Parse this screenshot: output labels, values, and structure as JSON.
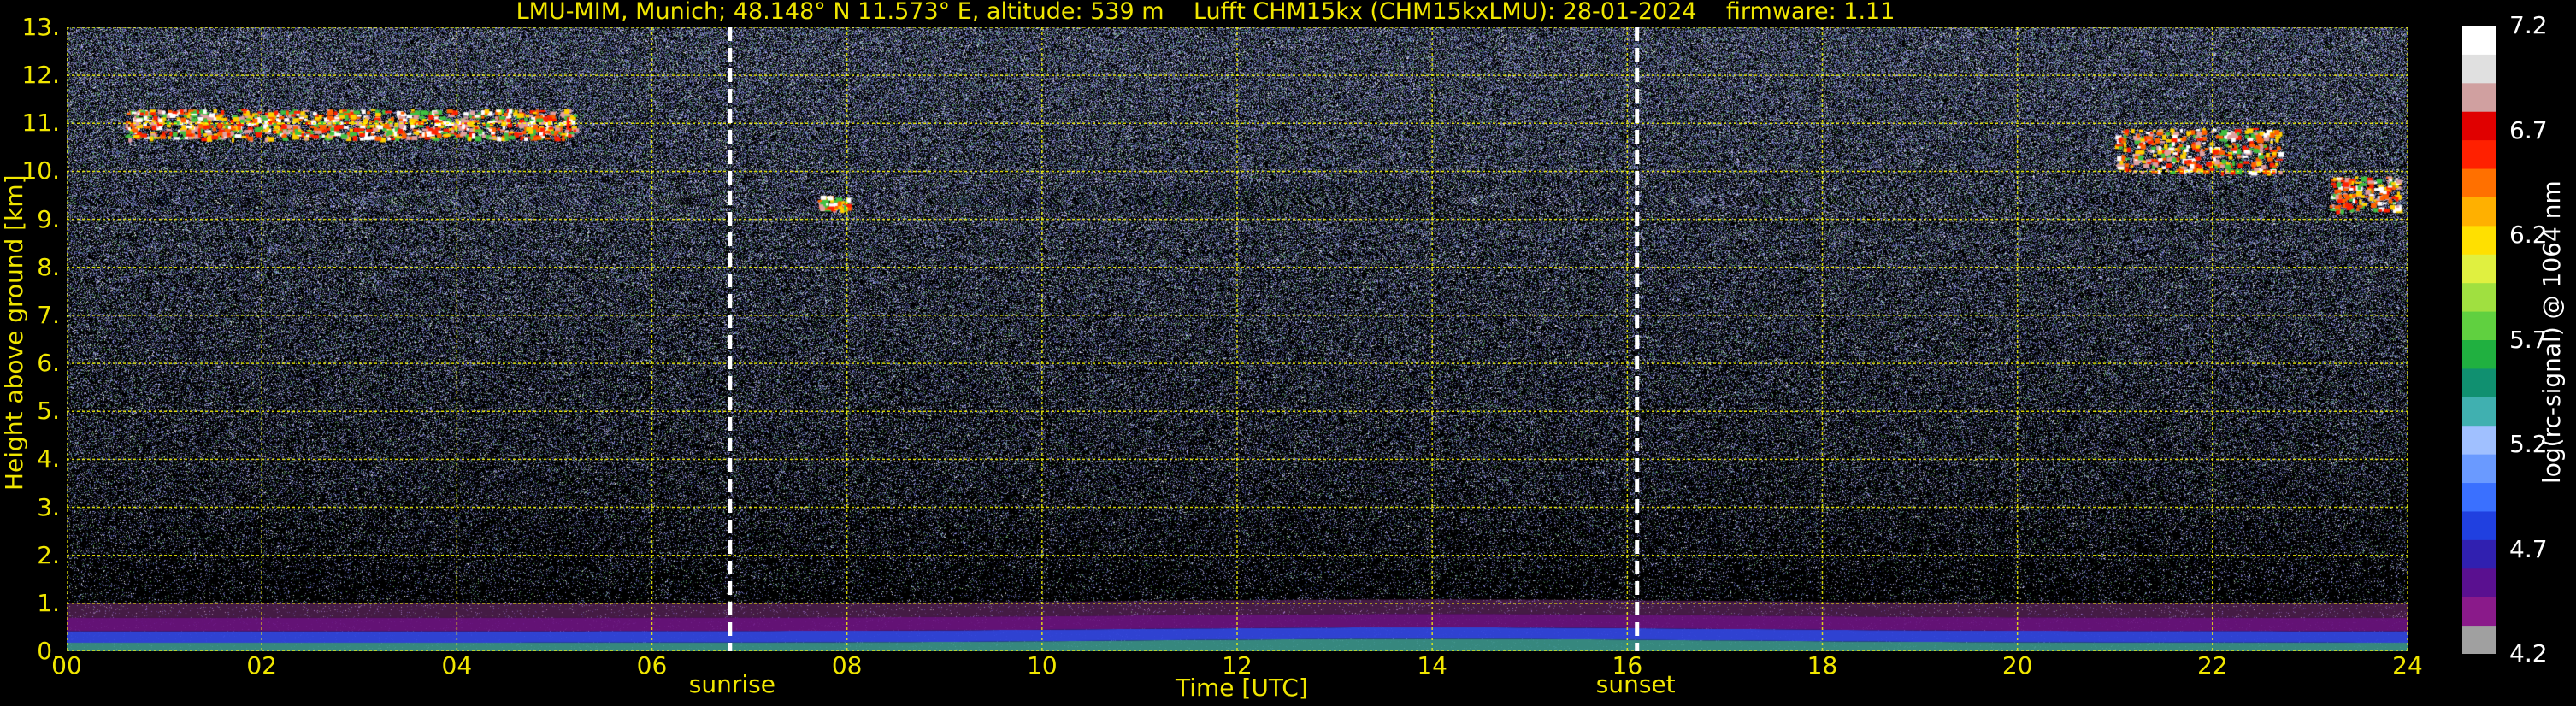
{
  "header": {
    "title": "LMU-MIM, Munich; 48.148° N 11.573° E, altitude: 539 m    Lufft CHM15kx (CHM15kxLMU): 28-01-2024    firmware: 1.11"
  },
  "chart_data": {
    "type": "heatmap",
    "xlabel": "Time [UTC]",
    "ylabel": "Height above ground [km]",
    "xlim": [
      0,
      24
    ],
    "ylim": [
      0,
      13
    ],
    "x_tick_labels": [
      "00",
      "02",
      "04",
      "06",
      "08",
      "10",
      "12",
      "14",
      "16",
      "18",
      "20",
      "22",
      "24"
    ],
    "y_tick_labels": [
      "0.",
      "1.",
      "2.",
      "3.",
      "4.",
      "5.",
      "6.",
      "7.",
      "8.",
      "9.",
      "10.",
      "11.",
      "12.",
      "13."
    ],
    "grid": true,
    "grid_color": "#ffff00",
    "background_color": "#000000",
    "annotations": [
      {
        "label": "sunrise",
        "x": 6.8
      },
      {
        "label": "sunset",
        "x": 16.1
      }
    ],
    "colorbar": {
      "label": "log(rc-signal) @ 1064 nm",
      "range": [
        4.2,
        7.2
      ],
      "tick_values": [
        4.2,
        4.7,
        5.2,
        5.7,
        6.2,
        6.7,
        7.2
      ],
      "tick_labels": [
        "4.2",
        "4.7",
        "5.2",
        "5.7",
        "6.2",
        "6.7",
        "7.2"
      ],
      "colors": [
        "#a0a0a0",
        "#8a1a8a",
        "#5a1090",
        "#3020b0",
        "#2040e0",
        "#3a70ff",
        "#6a9aff",
        "#a0c0ff",
        "#40b0b0",
        "#109070",
        "#20b040",
        "#60d040",
        "#a0e040",
        "#e0f040",
        "#ffe000",
        "#ffb000",
        "#ff7000",
        "#ff2000",
        "#e00000",
        "#d0a0a0",
        "#e0e0e0",
        "#ffffff"
      ]
    },
    "features": [
      {
        "name": "boundary layer",
        "x_range": [
          0,
          24
        ],
        "y_range": [
          0,
          0.6
        ]
      },
      {
        "name": "cirrus",
        "x_range": [
          0.6,
          5.2
        ],
        "y_range": [
          10.7,
          11.3
        ]
      },
      {
        "name": "cirrus",
        "x_range": [
          7.7,
          8.0
        ],
        "y_range": [
          9.2,
          9.5
        ]
      },
      {
        "name": "cirrus",
        "x_range": [
          21.0,
          22.7
        ],
        "y_range": [
          10.0,
          10.9
        ]
      },
      {
        "name": "cirrus",
        "x_range": [
          23.2,
          23.9
        ],
        "y_range": [
          9.2,
          9.9
        ]
      }
    ]
  }
}
